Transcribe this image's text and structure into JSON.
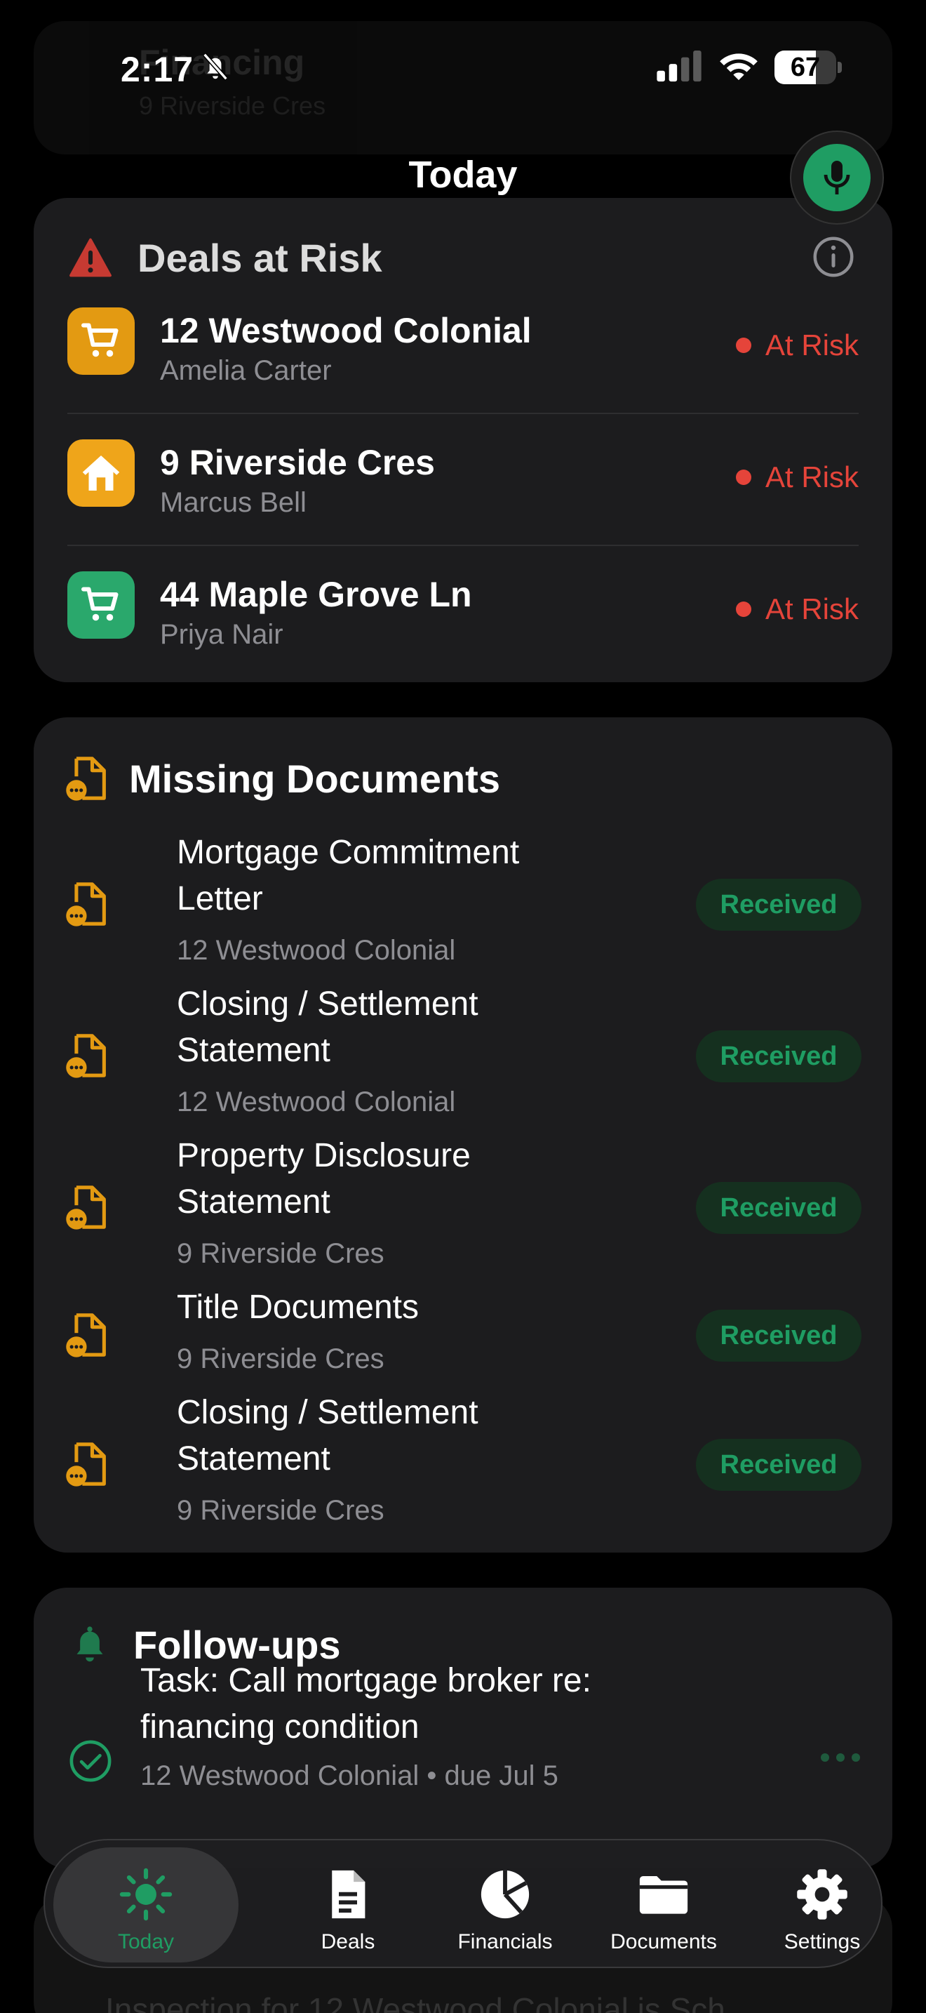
{
  "status_bar": {
    "time": "2:17",
    "battery": "67",
    "battery_level": 0.67
  },
  "background_header": {
    "title": "Financing",
    "subtitle": "9 Riverside Cres"
  },
  "page": {
    "title": "Today"
  },
  "deals_at_risk": {
    "title": "Deals at Risk",
    "items": [
      {
        "name": "12 Westwood Colonial",
        "client": "Amelia Carter",
        "status": "At Risk",
        "icon": "cart-icon",
        "color": "#e39a12"
      },
      {
        "name": "9 Riverside Cres",
        "client": "Marcus Bell",
        "status": "At Risk",
        "icon": "house-icon",
        "color": "#efa51a"
      },
      {
        "name": "44 Maple Grove Ln",
        "client": "Priya Nair",
        "status": "At Risk",
        "icon": "cart-icon",
        "color": "#2aa86c"
      }
    ]
  },
  "missing_documents": {
    "title": "Missing Documents",
    "items": [
      {
        "line1": "Mortgage Commitment",
        "line2": "Letter",
        "deal": "12 Westwood Colonial",
        "status": "Received"
      },
      {
        "line1": "Closing / Settlement",
        "line2": "Statement",
        "deal": "12 Westwood Colonial",
        "status": "Received"
      },
      {
        "line1": "Property Disclosure",
        "line2": "Statement",
        "deal": "9 Riverside Cres",
        "status": "Received"
      },
      {
        "line1": "Title Documents",
        "line2": "",
        "deal": "9 Riverside Cres",
        "status": "Received"
      },
      {
        "line1": "Closing / Settlement",
        "line2": "Statement",
        "deal": "9 Riverside Cres",
        "status": "Received"
      }
    ]
  },
  "follow_ups": {
    "title": "Follow-ups",
    "task": {
      "line1": "Task: Call mortgage broker re:",
      "line2": "financing condition",
      "meta": "12 Westwood Colonial • due Jul 5"
    }
  },
  "ghost_below": {
    "text": "Inspection for 12 Westwood Colonial is Sch"
  },
  "tabs": [
    {
      "label": "Today",
      "icon": "sun-icon",
      "active": true
    },
    {
      "label": "Deals",
      "icon": "document-icon",
      "active": false
    },
    {
      "label": "Financials",
      "icon": "pie-chart-icon",
      "active": false
    },
    {
      "label": "Documents",
      "icon": "folder-icon",
      "active": false
    },
    {
      "label": "Settings",
      "icon": "gear-icon",
      "active": false
    }
  ],
  "colors": {
    "accent": "#1f9d63",
    "danger": "#e5443a",
    "warning": "#e39a12",
    "card": "#1c1c1e"
  }
}
